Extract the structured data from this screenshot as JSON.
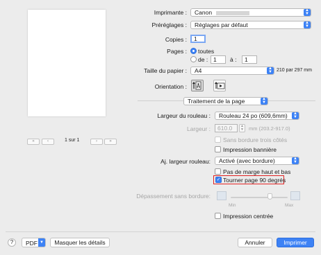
{
  "preview": {
    "page_indicator": "1 sur 1",
    "nav": {
      "first": "«",
      "prev": "‹",
      "next": "›",
      "last": "»"
    }
  },
  "printer": {
    "label": "Imprimante :",
    "value": "Canon"
  },
  "presets": {
    "label": "Préréglages :",
    "value": "Réglages par défaut"
  },
  "copies": {
    "label": "Copies :",
    "value": "1"
  },
  "pages": {
    "label": "Pages :",
    "all_label": "toutes",
    "range_from_label": "de :",
    "range_from": "1",
    "range_to_label": "à :",
    "range_to": "1"
  },
  "paper_size": {
    "label": "Taille du papier :",
    "value": "A4",
    "dimensions": "210 par 297 mm"
  },
  "orientation": {
    "label": "Orientation :"
  },
  "section_popup": "Traitement de la page",
  "roll_width": {
    "label": "Largeur du rouleau :",
    "value": "Rouleau 24 po (609,6mm)"
  },
  "width": {
    "label": "Largeur :",
    "value": "610.0",
    "units": "mm (203.2-917.0)"
  },
  "borderless_three_sides": "Sans bordure trois côtés",
  "banner_printing": "Impression bannière",
  "adjust_roll_width": {
    "label": "Aj. largeur rouleau:",
    "value": "Activé (avec bordure)"
  },
  "no_top_bottom_margin": "Pas de marge haut et bas",
  "rotate_90": "Tourner page 90 degrés",
  "borderless_overflow": {
    "label": "Dépassement sans bordure:",
    "min": "Min",
    "max": "Max"
  },
  "center_printing": "Impression centrée",
  "footer": {
    "help": "?",
    "pdf": "PDF",
    "hide_details": "Masquer les détails",
    "cancel": "Annuler",
    "print": "Imprimer"
  },
  "colors": {
    "accent": "#3d82f5",
    "highlight_border": "#e02020"
  }
}
